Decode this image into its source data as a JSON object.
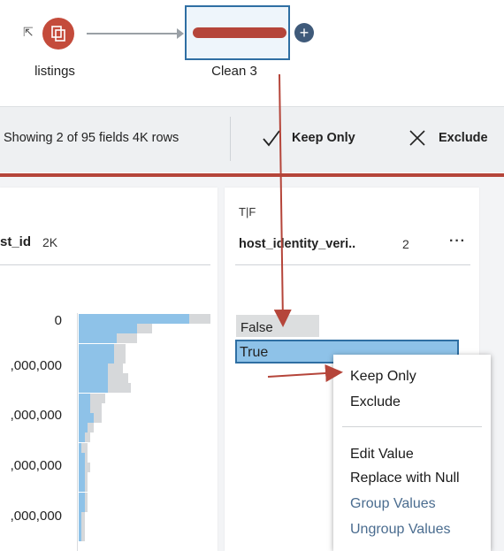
{
  "flow": {
    "input_node_label": "listings",
    "step_node_label": "Clean 3",
    "add_step_symbol": "+"
  },
  "toolbar": {
    "fields_info": "Showing 2 of 95 fields  4K rows",
    "keep_only_label": "Keep Only",
    "exclude_label": "Exclude"
  },
  "profile": {
    "left_field": {
      "name": "st_id",
      "count": "2K",
      "ticks": [
        "0",
        ",000,000",
        ",000,000",
        ",000,000",
        ",000,000"
      ],
      "bars": [
        {
          "total": 0.45,
          "selected": 0.38
        },
        {
          "total": 0.25,
          "selected": 0.2
        },
        {
          "total": 0.2,
          "selected": 0.13
        },
        {
          "total": 0.16,
          "selected": 0.12
        },
        {
          "total": 0.16,
          "selected": 0.12
        },
        {
          "total": 0.15,
          "selected": 0.1
        },
        {
          "total": 0.17,
          "selected": 0.1
        },
        {
          "total": 0.18,
          "selected": 0.1
        },
        {
          "total": 0.09,
          "selected": 0.04
        },
        {
          "total": 0.08,
          "selected": 0.04
        },
        {
          "total": 0.08,
          "selected": 0.05
        },
        {
          "total": 0.05,
          "selected": 0.03
        },
        {
          "total": 0.04,
          "selected": 0.02
        },
        {
          "total": 0.03,
          "selected": 0.01
        },
        {
          "total": 0.03,
          "selected": 0.02
        },
        {
          "total": 0.04,
          "selected": 0.02
        },
        {
          "total": 0.03,
          "selected": 0.02
        },
        {
          "total": 0.03,
          "selected": 0.02
        },
        {
          "total": 0.03,
          "selected": 0.02
        },
        {
          "total": 0.03,
          "selected": 0.02
        },
        {
          "total": 0.02,
          "selected": 0.01
        },
        {
          "total": 0.02,
          "selected": 0.01
        },
        {
          "total": 0.02,
          "selected": 0.01
        }
      ]
    },
    "right_field": {
      "type_icon": "T|F",
      "name": "host_identity_veri..",
      "count": "2",
      "menu": "···",
      "values": [
        "False",
        "True"
      ]
    }
  },
  "context_menu": {
    "items": [
      "Keep Only",
      "Exclude",
      "Edit Value",
      "Replace with Null",
      "Group Values",
      "Ungroup Values"
    ]
  },
  "colors": {
    "accent_red": "#b5453a",
    "selection_blue": "#8ec2e8",
    "node_border": "#2f6fa3"
  }
}
